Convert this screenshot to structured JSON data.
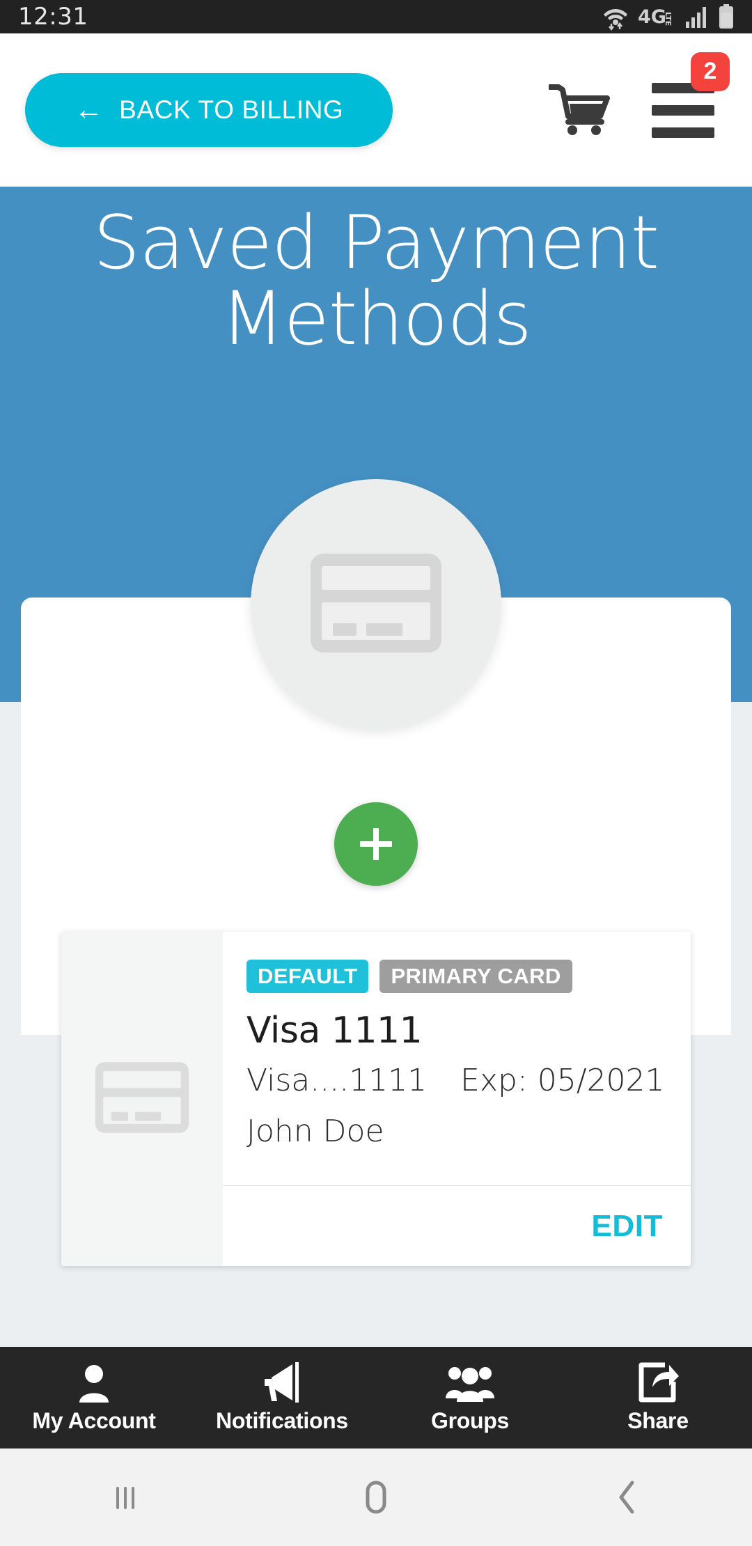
{
  "status_bar": {
    "time": "12:31",
    "icons": [
      "wifi-icon",
      "4glte-icon",
      "signal-icon",
      "battery-icon"
    ],
    "network_label": "4G",
    "network_sub": "LTE",
    "background": "#222222"
  },
  "topbar": {
    "back_label": "BACK TO BILLING",
    "back_arrow": "←",
    "cart_icon": "cart-icon",
    "menu_icon": "hamburger-icon",
    "badge_count": "2",
    "badge_color": "#f4433c",
    "button_color": "#00bcd6"
  },
  "hero": {
    "title": "Saved Payment Methods",
    "background": "#4590c3",
    "avatar_icon": "credit-card-icon"
  },
  "actions": {
    "add_label": "+",
    "add_color": "#4cae50"
  },
  "payment_methods": [
    {
      "thumb_icon": "credit-card-icon",
      "badges": [
        {
          "label": "DEFAULT",
          "color": "#1fc0da"
        },
        {
          "label": "PRIMARY CARD",
          "color": "#9e9e9e"
        }
      ],
      "title": "Visa 1111",
      "masked_number": "Visa....1111",
      "expiry": "Exp: 05/2021",
      "holder": "John Doe",
      "edit_label": "EDIT",
      "edit_color": "#15bcd8"
    }
  ],
  "bottom_nav": {
    "items": [
      {
        "label": "My Account",
        "icon": "person-icon"
      },
      {
        "label": "Notifications",
        "icon": "megaphone-icon"
      },
      {
        "label": "Groups",
        "icon": "people-icon"
      },
      {
        "label": "Share",
        "icon": "share-icon"
      }
    ],
    "background": "#262626"
  },
  "system_nav": {
    "recents": "recents-icon",
    "home": "home-icon",
    "back": "back-icon",
    "background": "#f2f2f2"
  }
}
